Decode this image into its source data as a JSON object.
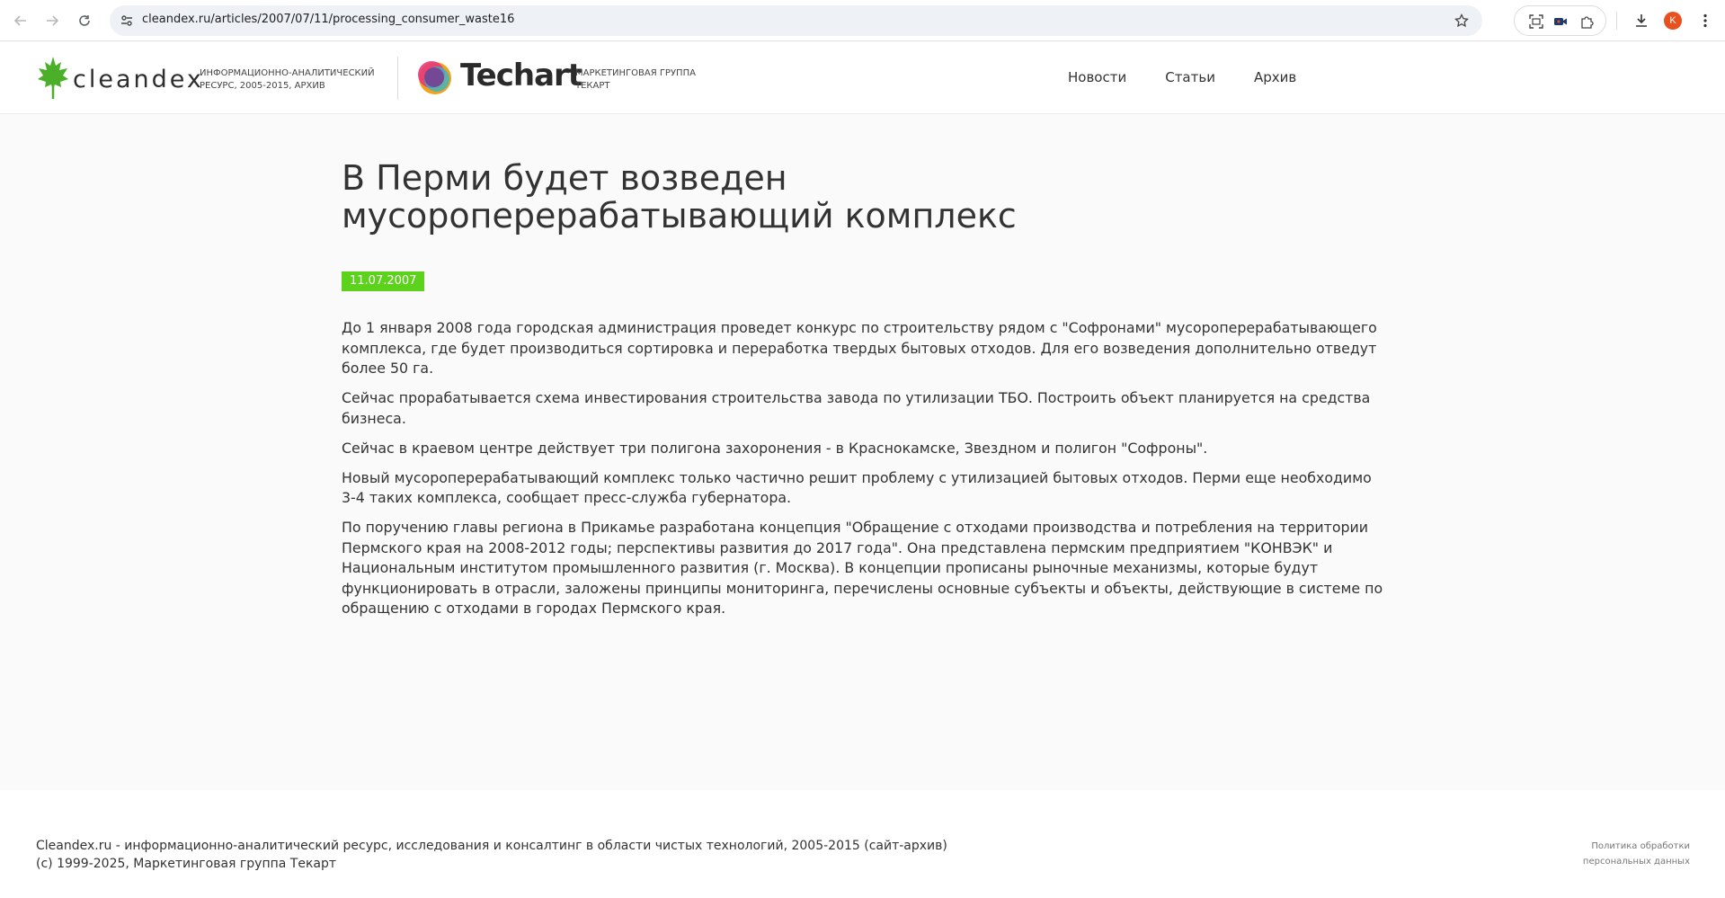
{
  "browser": {
    "url": "cleandex.ru/articles/2007/07/11/processing_consumer_waste16",
    "profile_initial": "K"
  },
  "header": {
    "logo_text": "cleandex",
    "logo_tagline": "Информационно-аналитический ресурс, 2005-2015, архив",
    "partner_text": "Techart",
    "partner_tagline": "Маркетинговая группа Текарт",
    "nav": [
      "Новости",
      "Статьи",
      "Архив"
    ]
  },
  "article": {
    "title": "В Перми будет возведен мусороперерабатывающий комплекс",
    "date": "11.07.2007",
    "paragraphs": [
      "До 1 января 2008 года городская администрация проведет конкурс по строительству рядом с \"Софронами\" мусороперерабатывающего комплекса, где будет производиться сортировка и переработка твердых бытовых отходов. Для его возведения дополнительно отведут более 50 га.",
      "Сейчас прорабатывается схема инвестирования строительства завода по утилизации ТБО. Построить объект планируется на средства бизнеса.",
      "Сейчас в краевом центре действует три полигона захоронения - в Краснокамске, Звездном и полигон \"Софроны\".",
      "Новый мусороперерабатывающий комплекс только частично решит проблему с утилизацией бытовых отходов. Перми еще необходимо 3-4 таких комплекса, сообщает пресс-служба губернатора.",
      "По поручению главы региона в Прикамье разработана концепция \"Обращение с отходами производства и потребления на территории Пермского края на 2008-2012 годы; перспективы развития до 2017 года\". Она представлена пермским предприятием \"КОНВЭК\" и Национальным институтом промышленного развития (г. Москва). В концепции прописаны рыночные механизмы, которые будут функционировать в отрасли, заложены принципы мониторинга, перечислены основные субъекты и объекты, действующие в системе по обращению с отходами в городах Пермского края."
    ]
  },
  "footer": {
    "description": "Cleandex.ru - информационно-аналитический ресурс, исследования и консалтинг в области чистых технологий, 2005-2015 (сайт-архив)",
    "copyright": "(c) 1999-2025, Маркетинговая группа Текарт",
    "policy_link": "Политика обработки персональных данных"
  },
  "colors": {
    "accent_green": "#5dd21c",
    "leaf_green": "#4caf2a",
    "profile_orange": "#e8501f",
    "page_background": "#fafafa"
  }
}
